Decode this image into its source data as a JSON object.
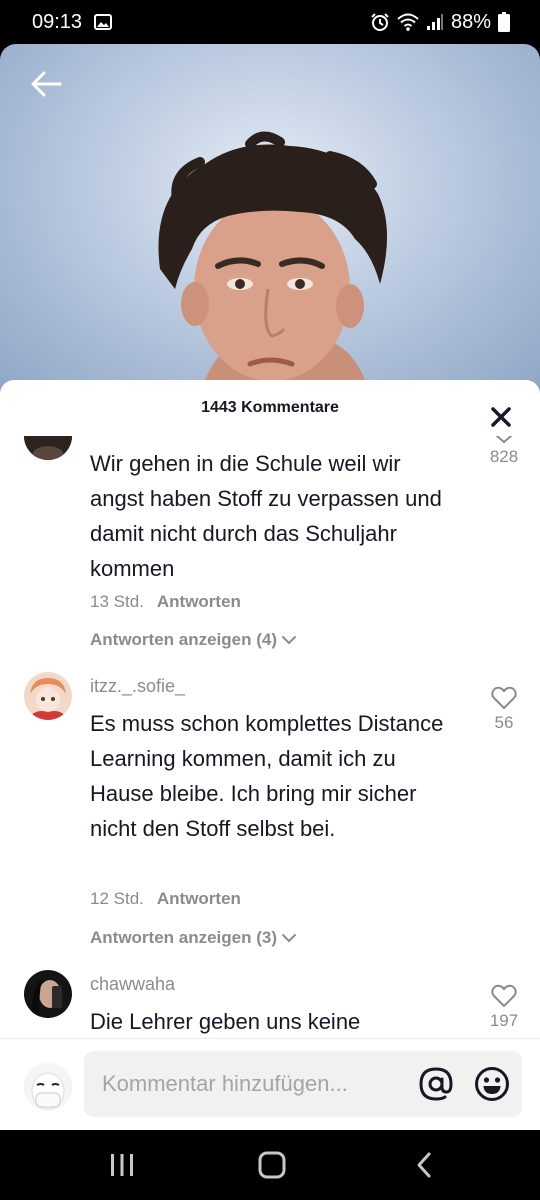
{
  "status_bar": {
    "time": "09:13",
    "battery": "88%"
  },
  "header": {
    "comment_count_label": "1443 Kommentare"
  },
  "comments": [
    {
      "username": "",
      "text": "Wir gehen in die Schule weil wir angst haben Stoff zu verpassen und damit nicht durch das Schuljahr kommen",
      "time": "13 Std.",
      "reply_label": "Antworten",
      "view_replies": "Antworten anzeigen (4)",
      "likes": "828"
    },
    {
      "username": "itzz._.sofie_",
      "text": "Es muss schon komplettes Distance Learning kommen, damit ich zu Hause bleibe. Ich bring mir sicher nicht den Stoff selbst bei.",
      "time": "12 Std.",
      "reply_label": "Antworten",
      "view_replies": "Antworten anzeigen (3)",
      "likes": "56"
    },
    {
      "username": "chawwaha",
      "text": "Die Lehrer geben uns keine",
      "likes": "197"
    }
  ],
  "composer": {
    "placeholder": "Kommentar hinzufügen..."
  },
  "colors": {
    "accent_text": "#161823",
    "muted_text": "#8a8b91",
    "input_bg": "#f1f1f2"
  },
  "icons": [
    "back-arrow-icon",
    "close-icon",
    "heart-icon",
    "chevron-down-icon",
    "at-icon",
    "emoji-icon",
    "recent-apps-icon",
    "home-icon",
    "back-icon"
  ]
}
